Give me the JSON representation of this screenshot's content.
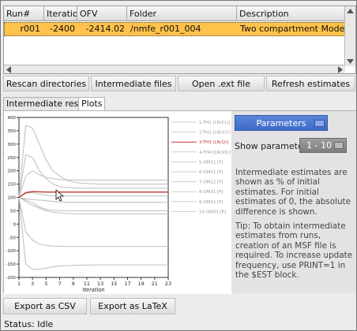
{
  "table": {
    "columns": [
      "Run#",
      "Iterations",
      "OFV",
      "Folder",
      "Description"
    ],
    "rows": [
      {
        "run": "r001",
        "iterations": "-2400",
        "ofv": "-2414.02",
        "folder": "/nmfe_r001_004",
        "description": "Two compartment Model."
      }
    ]
  },
  "actions": {
    "rescan": "Rescan directories",
    "intermediate_files": "Intermediate files",
    "open_ext": "Open .ext file",
    "refresh": "Refresh estimates"
  },
  "tabs": [
    {
      "label": "Intermediate results",
      "active": false
    },
    {
      "label": "Plots",
      "active": true
    }
  ],
  "right_panel": {
    "parameters_button": "Parameters",
    "show_label": "Show parameters:",
    "show_value": "1 - 10",
    "note1": "Intermediate estimates are shown as % of initial estimates. For initial estimates of 0, the absolute difference is shown.",
    "note2": "Tip: To obtain intermediate estimates from runs, creation of an MSF file is required. To increase update frequency, use PRINT=1 in the $EST block."
  },
  "export": {
    "csv": "Export as CSV",
    "latex": "Export as LaTeX"
  },
  "status": "Status: Idle",
  "colors": {
    "selected_row": "#ffc24a",
    "accent_button": "#4a76d0",
    "highlight_series": "#c0392b",
    "grey_series": "#bdbdbd"
  },
  "chart_data": {
    "type": "line",
    "xlabel": "Iteration",
    "ylabel": "",
    "xlim": [
      1,
      23
    ],
    "ylim": [
      -200,
      400
    ],
    "x_ticks": [
      "1",
      "3",
      "5",
      "7",
      "9",
      "11",
      "13",
      "15",
      "17",
      "19",
      "21",
      "23"
    ],
    "y_ticks": [
      "400",
      "350",
      "300",
      "250",
      "200",
      "150",
      "100",
      "50",
      "0",
      "-50",
      "-100",
      "-150",
      "-200"
    ],
    "x": [
      1,
      2,
      3,
      4,
      5,
      6,
      7,
      8,
      9,
      10,
      11,
      12,
      13,
      14,
      15,
      16,
      17,
      18,
      19,
      20,
      21,
      22,
      23
    ],
    "highlighted": "3-TH3 [LN(Q)]",
    "series": [
      {
        "name": "1-TH1 [LN(CL)]",
        "values": [
          100,
          370,
          360,
          300,
          240,
          200,
          180,
          165,
          158,
          154,
          152,
          151,
          150,
          150,
          150,
          150,
          150,
          150,
          150,
          150,
          150,
          150,
          150
        ]
      },
      {
        "name": "2-TH2 [LN(V1)]",
        "values": [
          100,
          260,
          250,
          200,
          170,
          150,
          140,
          137,
          136,
          135,
          135,
          135,
          135,
          135,
          135,
          135,
          135,
          135,
          135,
          135,
          135,
          135,
          135
        ]
      },
      {
        "name": "3-TH3 [LN(Q)]",
        "values": [
          100,
          118,
          122,
          121,
          120,
          120,
          120,
          120,
          120,
          120,
          120,
          120,
          120,
          120,
          120,
          120,
          120,
          120,
          120,
          120,
          120,
          120,
          120
        ]
      },
      {
        "name": "4-TH4 [LN(V2)]",
        "values": [
          100,
          85,
          70,
          60,
          50,
          45,
          42,
          40,
          39,
          38,
          38,
          38,
          38,
          38,
          38,
          38,
          38,
          38,
          38,
          38,
          38,
          38,
          38
        ]
      },
      {
        "name": "5-OM11 [P]",
        "values": [
          100,
          -150,
          -170,
          -170,
          -165,
          -160,
          -158,
          -156,
          -155,
          -154,
          -154,
          -153,
          -153,
          -153,
          -153,
          -153,
          -153,
          -153,
          -153,
          -153,
          -153,
          -153,
          -153
        ]
      },
      {
        "name": "6-OM21 [P]",
        "values": [
          100,
          -30,
          -60,
          -75,
          -80,
          -82,
          -83,
          -84,
          -84,
          -84,
          -84,
          -84,
          -84,
          -84,
          -84,
          -84,
          -84,
          -84,
          -84,
          -84,
          -84,
          -84,
          -84
        ]
      },
      {
        "name": "7-OM22 [P]",
        "values": [
          100,
          180,
          200,
          185,
          175,
          170,
          167,
          166,
          165,
          165,
          165,
          165,
          165,
          165,
          165,
          165,
          165,
          165,
          165,
          165,
          165,
          165,
          165
        ]
      },
      {
        "name": "8-OM31 [P]",
        "values": [
          100,
          90,
          80,
          65,
          55,
          52,
          50,
          50,
          50,
          50,
          50,
          50,
          50,
          50,
          50,
          50,
          50,
          50,
          50,
          50,
          50,
          50,
          50
        ]
      },
      {
        "name": "9-OM32 [P]",
        "values": [
          100,
          95,
          92,
          90,
          88,
          85,
          83,
          82,
          82,
          82,
          82,
          82,
          82,
          82,
          82,
          82,
          82,
          82,
          82,
          82,
          82,
          82,
          82
        ]
      },
      {
        "name": "10-OM33 [P]",
        "values": [
          100,
          115,
          118,
          112,
          108,
          106,
          105,
          105,
          105,
          105,
          105,
          105,
          105,
          105,
          105,
          105,
          105,
          105,
          105,
          105,
          105,
          105,
          105
        ]
      }
    ]
  }
}
